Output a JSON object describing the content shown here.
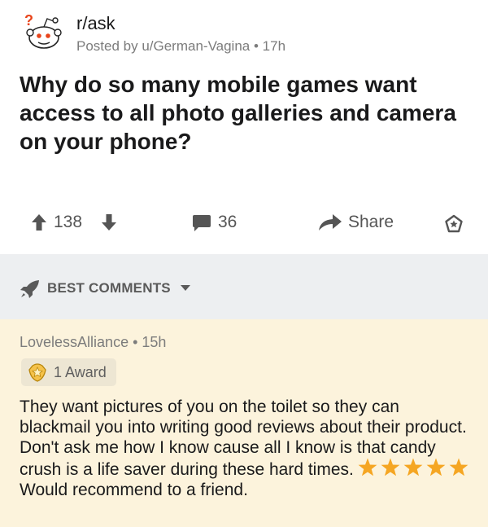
{
  "post": {
    "subreddit": "r/ask",
    "posted_by": "Posted by u/German-Vagina",
    "age": "17h",
    "title": "Why do so many mobile games want access to all photo galleries and camera on your phone?"
  },
  "actions": {
    "score": "138",
    "comment_count": "36",
    "share_label": "Share"
  },
  "sort": {
    "label": "BEST COMMENTS"
  },
  "comment": {
    "author": "LovelessAlliance",
    "age": "15h",
    "award_label": "1 Award",
    "body_before_stars": "They want pictures of you on the toilet so they can blackmail you into writing good reviews about their product. Don't ask me how I know cause all I know is that candy crush is a life saver during these hard times.",
    "star_count": 5,
    "body_after_stars": "Would recommend to a friend."
  },
  "colors": {
    "accent_star": "#f5a623",
    "comment_bg": "#fcf3dc",
    "sort_bg": "#edeff1",
    "icon_gray": "#555555"
  }
}
